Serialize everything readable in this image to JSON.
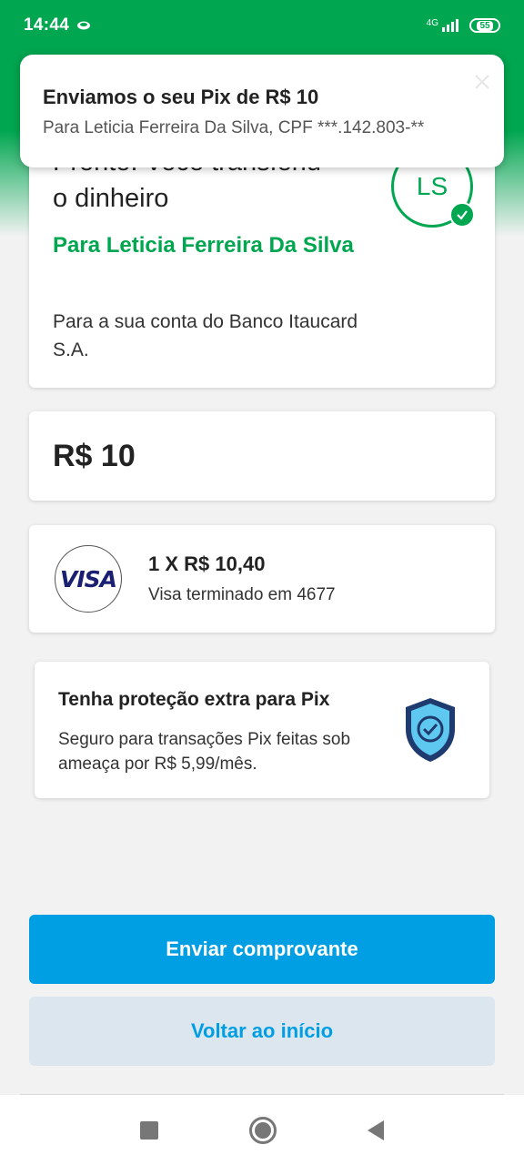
{
  "status_bar": {
    "time": "14:44",
    "network": "4G",
    "battery": "55"
  },
  "notification": {
    "title": "Enviamos o seu Pix de R$ 10",
    "body": "Para Leticia Ferreira Da Silva, CPF ***.142.803-**"
  },
  "transfer": {
    "title_line1": "Pronto! Você transferiu",
    "title_line2": "o dinheiro",
    "recipient": "Para Leticia Ferreira Da Silva",
    "bank": "Para a sua conta do Banco Itaucard S.A.",
    "avatar_initials": "LS"
  },
  "amount": "R$ 10",
  "payment": {
    "brand": "VISA",
    "installments": "1 X R$ 10,40",
    "card_desc": "Visa terminado em 4677"
  },
  "protection": {
    "title": "Tenha proteção extra para Pix",
    "description": "Seguro para transações Pix feitas sob ameaça por R$ 5,99/mês."
  },
  "buttons": {
    "send_receipt": "Enviar comprovante",
    "back_home": "Voltar ao início"
  },
  "colors": {
    "brand_green": "#00a650",
    "primary_blue": "#009ee3",
    "secondary_bg": "#dce6ef"
  },
  "icons": {
    "status_app": "message-icon",
    "shield": "shield-check-icon",
    "nav": [
      "recent-apps-icon",
      "home-icon",
      "back-icon"
    ]
  }
}
